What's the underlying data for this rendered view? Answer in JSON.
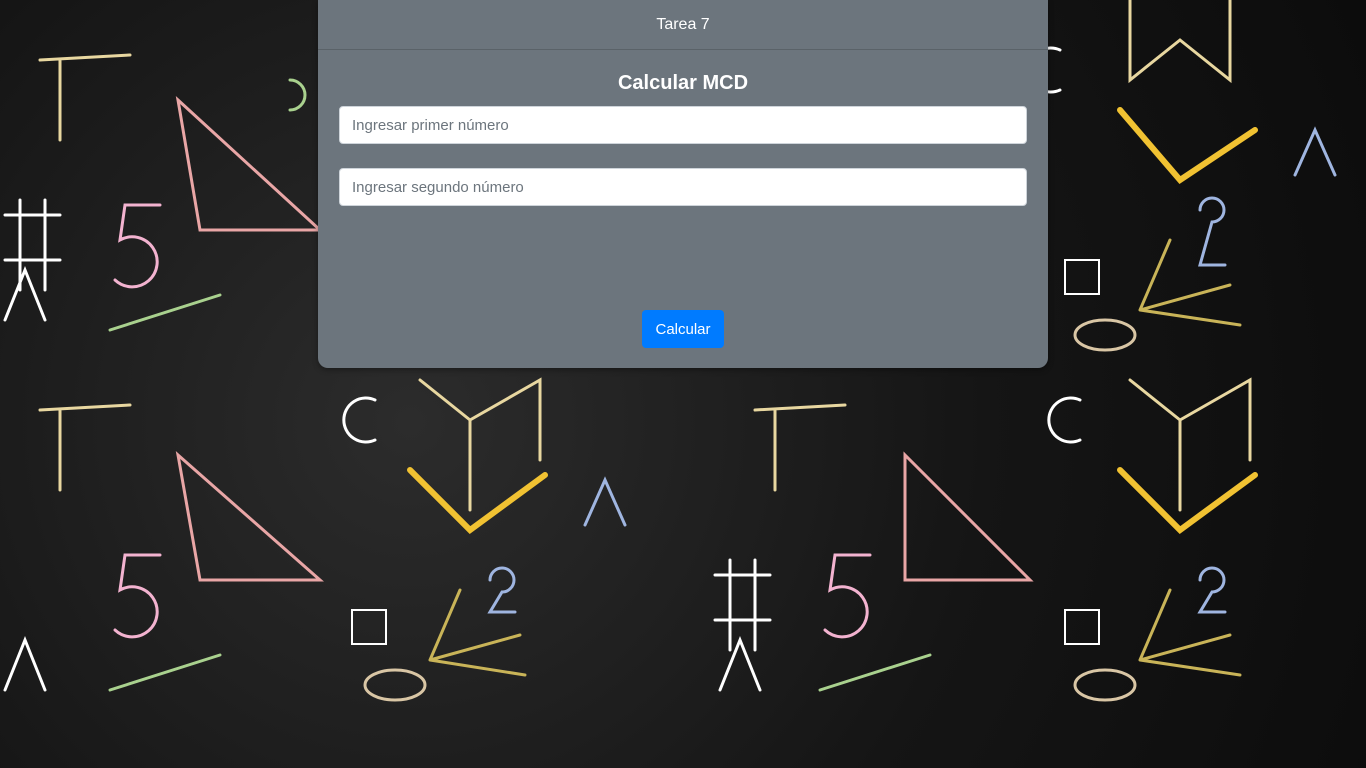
{
  "header": {
    "title": "Tarea 7"
  },
  "form": {
    "title": "Calcular MCD",
    "first_number": {
      "value": "",
      "placeholder": "Ingresar primer número"
    },
    "second_number": {
      "value": "",
      "placeholder": "Ingresar segundo número"
    },
    "submit_label": "Calcular"
  },
  "background": {
    "description_icons": [
      "math-doodle-pattern"
    ],
    "colors": {
      "chalkboard": "#141414",
      "card": "#6c757d",
      "button": "#007bff"
    }
  }
}
